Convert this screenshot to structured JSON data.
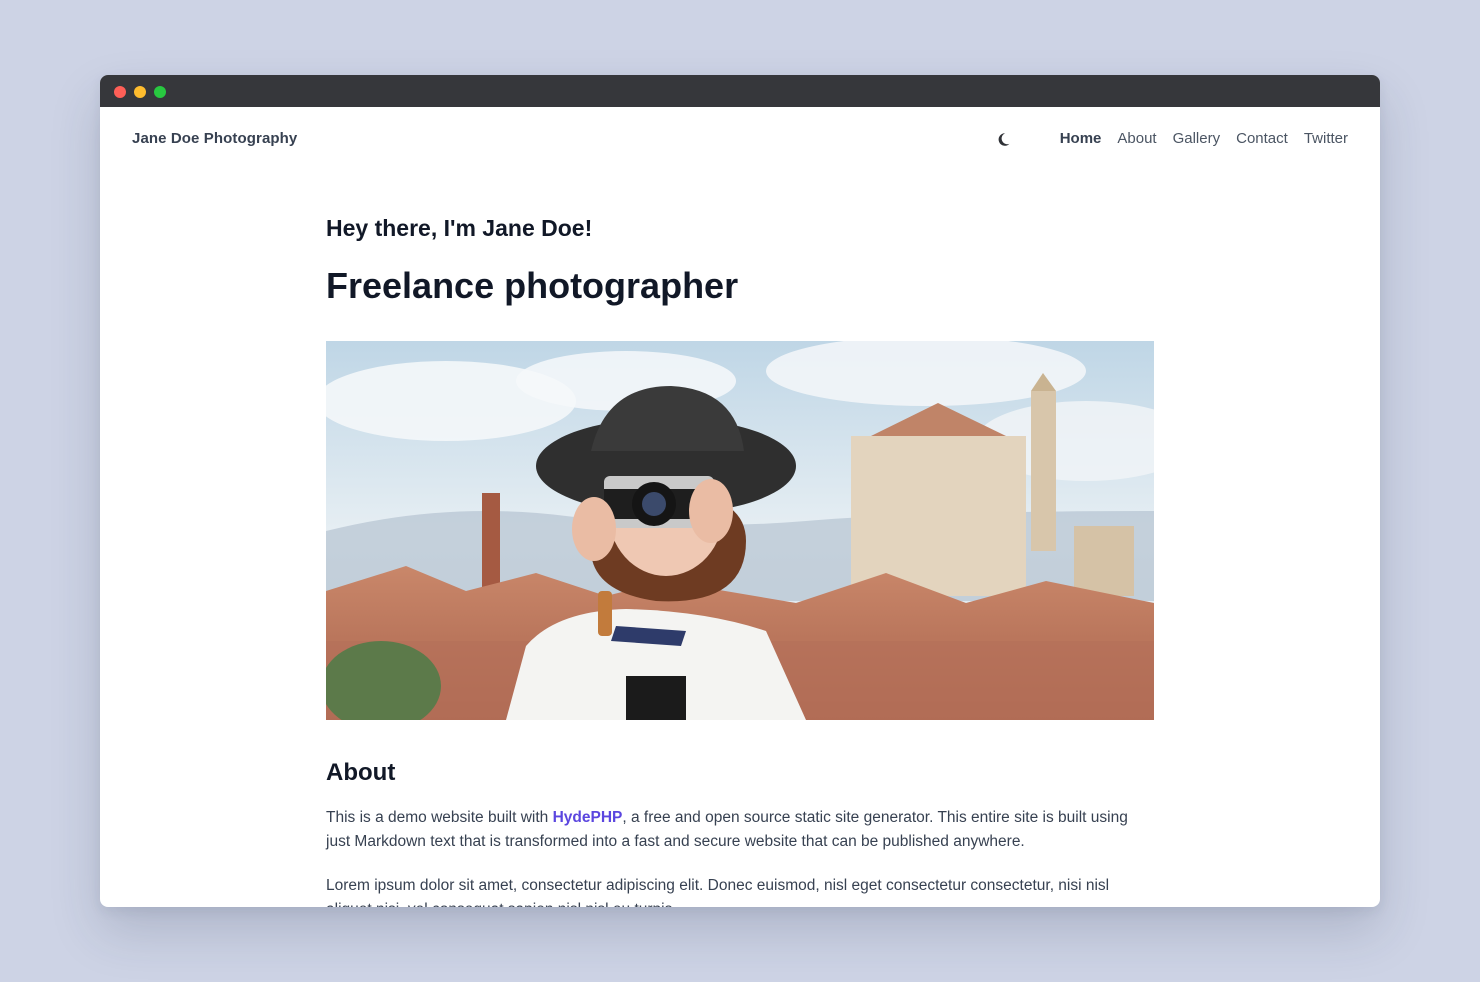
{
  "site": {
    "brand": "Jane Doe Photography"
  },
  "nav": {
    "theme_toggle_icon": "moon-icon",
    "links": [
      "Home",
      "About",
      "Gallery",
      "Contact",
      "Twitter"
    ],
    "active": "Home"
  },
  "hero": {
    "greeting": "Hey there, I'm Jane Doe!",
    "headline": "Freelance photographer"
  },
  "about": {
    "heading": "About",
    "p1_before": "This is a demo website built with ",
    "p1_link": "HydePHP",
    "p1_after": ", a free and open source static site generator. This entire site is built using just Markdown text that is transformed into a fast and secure website that can be published anywhere.",
    "p2": "Lorem ipsum dolor sit amet, consectetur adipiscing elit. Donec euismod, nisl eget consectetur consectetur, nisi nisl aliquet nisi, vel consequat sapien nisl nisl eu turpis."
  },
  "colors": {
    "page_bg": "#cdd3e5",
    "titlebar": "#36373b",
    "link": "#5b46df",
    "heading": "#111827",
    "body_text": "#374151"
  }
}
